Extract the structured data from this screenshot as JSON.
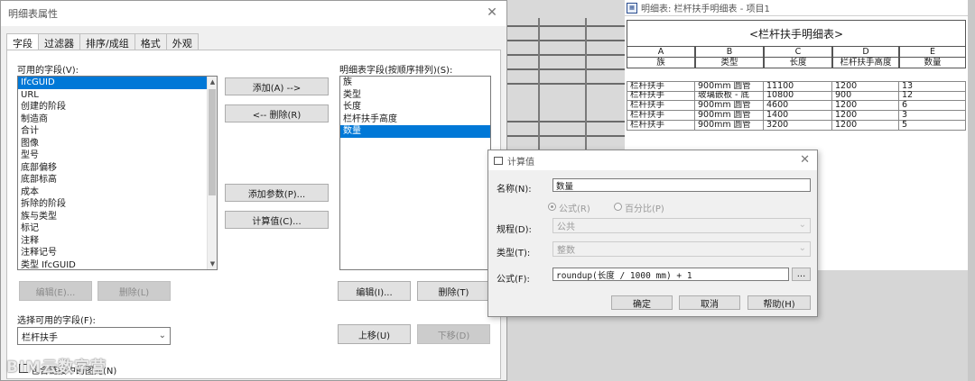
{
  "main_dialog": {
    "title": "明细表属性",
    "tabs": [
      "字段",
      "过滤器",
      "排序/成组",
      "格式",
      "外观"
    ],
    "available_fields_label": "可用的字段(V):",
    "available_fields": [
      "IfcGUID",
      "URL",
      "创建的阶段",
      "制造商",
      "合计",
      "图像",
      "型号",
      "底部偏移",
      "底部标高",
      "成本",
      "拆除的阶段",
      "族与类型",
      "标记",
      "注释",
      "注释记号",
      "类型 IfcGUID"
    ],
    "selected_available": "IfcGUID",
    "schedule_fields_label": "明细表字段(按顺序排列)(S):",
    "schedule_fields": [
      "族",
      "类型",
      "长度",
      "栏杆扶手高度",
      "数量"
    ],
    "selected_schedule": "数量",
    "buttons": {
      "add": "添加(A) -->",
      "remove": "<-- 删除(R)",
      "add_param": "添加参数(P)...",
      "calc_value": "计算值(C)...",
      "edit_left": "编辑(E)...",
      "delete_left": "删除(L)",
      "edit_right": "编辑(I)...",
      "delete_right": "删除(T)",
      "move_up": "上移(U)",
      "move_down": "下移(D)"
    },
    "select_from_label": "选择可用的字段(F):",
    "select_from_value": "栏杆扶手",
    "include_linked": "包含链接中的图元(N)"
  },
  "watermark": "BIM云数字营",
  "schedule": {
    "window_title": "明细表: 栏杆扶手明细表 - 项目1",
    "heading": "<栏杆扶手明细表>",
    "col_letters": [
      "A",
      "B",
      "C",
      "D",
      "E"
    ],
    "col_names": [
      "族",
      "类型",
      "长度",
      "栏杆扶手高度",
      "数量"
    ],
    "rows": [
      [
        "栏杆扶手",
        "900mm 圆管",
        "11100",
        "1200",
        "13"
      ],
      [
        "栏杆扶手",
        "玻璃嵌板 - 底",
        "10800",
        "900",
        "12"
      ],
      [
        "栏杆扶手",
        "900mm 圆管",
        "4600",
        "1200",
        "6"
      ],
      [
        "栏杆扶手",
        "900mm 圆管",
        "1400",
        "1200",
        "3"
      ],
      [
        "栏杆扶手",
        "900mm 圆管",
        "3200",
        "1200",
        "5"
      ]
    ]
  },
  "calc_dialog": {
    "title": "计算值",
    "name_label": "名称(N):",
    "name_value": "数量",
    "radio_formula": "公式(R)",
    "radio_percent": "百分比(P)",
    "discipline_label": "规程(D):",
    "discipline_value": "公共",
    "type_label": "类型(T):",
    "type_value": "整数",
    "formula_label": "公式(F):",
    "formula_value": "roundup(长度 / 1000 mm) + 1",
    "browse": "...",
    "ok": "确定",
    "cancel": "取消",
    "help": "帮助(H)"
  }
}
